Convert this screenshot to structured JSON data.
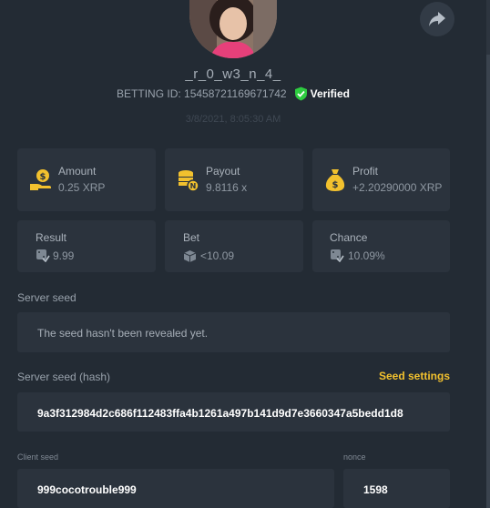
{
  "profile": {
    "username": "_r_0_w3_n_4_",
    "betting_id": "BETTING ID: 15458721169671742",
    "verified_label": "Verified",
    "timestamp": "3/8/2021, 8:05:30 AM"
  },
  "stats": {
    "amount": {
      "label": "Amount",
      "value": "0.25 XRP",
      "icon": "money-hand-icon"
    },
    "payout": {
      "label": "Payout",
      "value": "9.8116 x",
      "icon": "coin-stack-icon"
    },
    "profit": {
      "label": "Profit",
      "value": "+2.20290000 XRP",
      "icon": "money-bag-icon"
    },
    "result": {
      "label": "Result",
      "value": "9.99",
      "icon": "dice-check-icon"
    },
    "bet": {
      "label": "Bet",
      "value": "<10.09",
      "icon": "cube-icon"
    },
    "chance": {
      "label": "Chance",
      "value": "10.09%",
      "icon": "dice-check-icon"
    }
  },
  "seeds": {
    "server_seed_label": "Server seed",
    "server_seed_value": "The seed hasn't been revealed yet.",
    "server_hash_label": "Server seed (hash)",
    "seed_settings_label": "Seed settings",
    "server_hash_value": "9a3f312984d2c686f112483ffa4b1261a497b141d9d7e3660347a5bedd1d8",
    "client_seed_label": "Client seed",
    "client_seed_value": "999cocotrouble999",
    "nonce_label": "nonce",
    "nonce_value": "1598"
  },
  "colors": {
    "background": "#232b34",
    "card": "#2b333d",
    "accent_yellow": "#f2c12e",
    "verified_green": "#2ecc40"
  }
}
